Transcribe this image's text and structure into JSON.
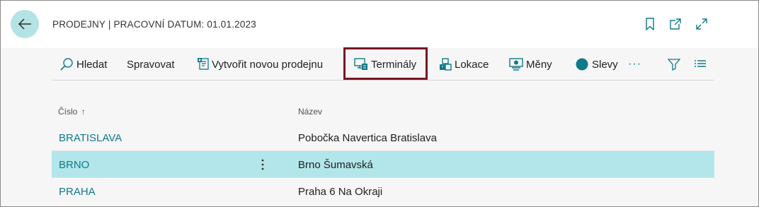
{
  "header": {
    "title": "PRODEJNY | PRACOVNÍ DATUM: 01.01.2023",
    "back_icon": "arrow-left-icon",
    "icons": [
      "bookmark-icon",
      "open-new-window-icon",
      "expand-icon"
    ]
  },
  "actionbar": {
    "search_label": "Hledat",
    "manage_label": "Spravovat",
    "new_store_label": "Vytvořit novou prodejnu",
    "terminals_label": "Terminály",
    "locations_label": "Lokace",
    "currencies_label": "Měny",
    "discounts_label": "Slevy",
    "more_label": "···"
  },
  "list": {
    "columns": [
      {
        "label": "Číslo",
        "sort": "ascending"
      },
      {
        "label": "Název"
      }
    ],
    "rows": [
      {
        "code": "BRATISLAVA",
        "name": "Pobočka Navertica Bratislava",
        "selected": false
      },
      {
        "code": "BRNO",
        "name": "Brno Šumavská",
        "selected": true
      },
      {
        "code": "PRAHA",
        "name": "Praha 6 Na Okraji",
        "selected": false
      }
    ]
  },
  "colors": {
    "accent": "#0f7a8a",
    "selected_row": "#b3e6ea",
    "back_button": "#b4e3e6",
    "highlight_border": "#7a1423",
    "content_bg": "#f6f6f6"
  }
}
